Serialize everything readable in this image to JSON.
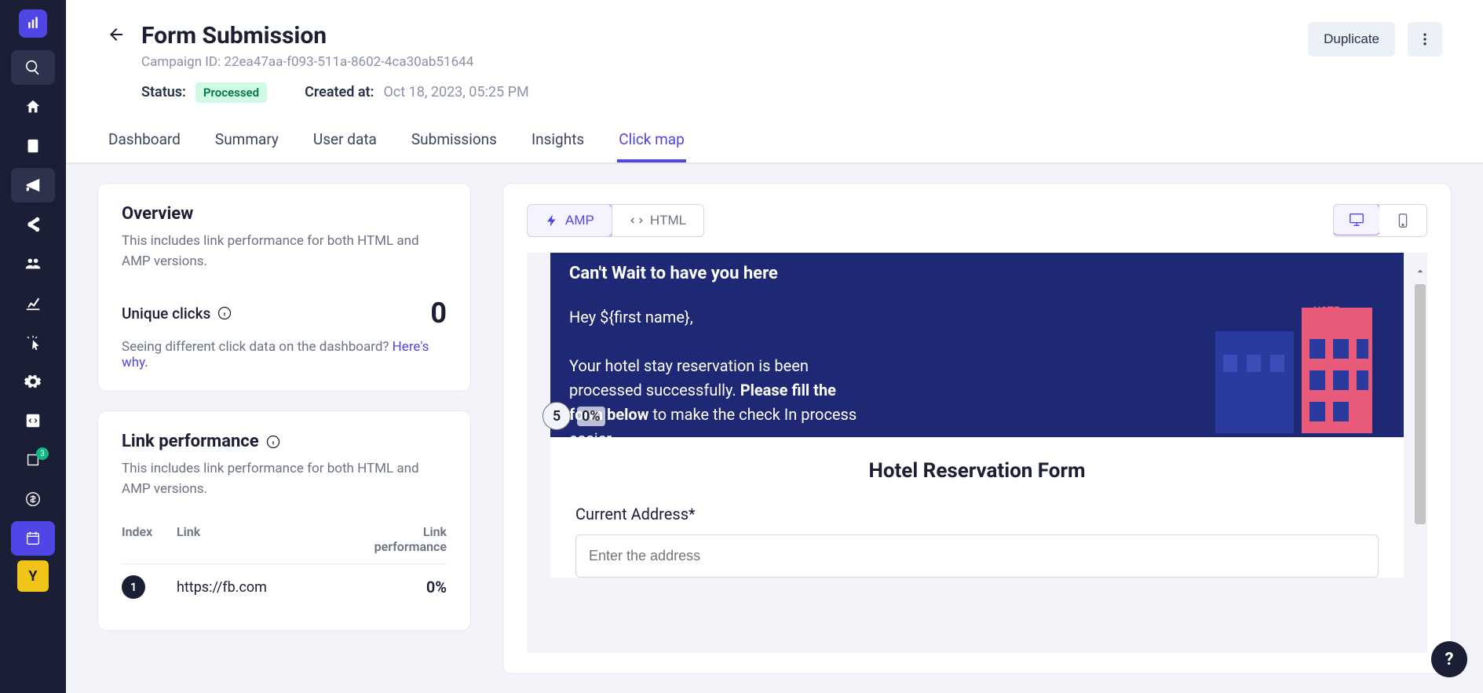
{
  "sidebar": {
    "badge_count": "3",
    "yellow_letter": "Y"
  },
  "header": {
    "title": "Form Submission",
    "campaign_id": "Campaign ID: 22ea47aa-f093-511a-8602-4ca30ab51644",
    "duplicate_label": "Duplicate",
    "status_label": "Status:",
    "status_value": "Processed",
    "created_label": "Created at:",
    "created_value": "Oct 18, 2023, 05:25 PM"
  },
  "tabs": [
    {
      "label": "Dashboard"
    },
    {
      "label": "Summary"
    },
    {
      "label": "User data"
    },
    {
      "label": "Submissions"
    },
    {
      "label": "Insights"
    },
    {
      "label": "Click map"
    }
  ],
  "overview": {
    "title": "Overview",
    "desc": "This includes link performance for both HTML and AMP versions.",
    "unique_label": "Unique clicks",
    "unique_value": "0",
    "help_text": "Seeing different click data on the dashboard? ",
    "help_link": "Here's why."
  },
  "link_perf": {
    "title": "Link performance",
    "desc": "This includes link performance for both HTML and AMP versions.",
    "col_index": "Index",
    "col_link": "Link",
    "col_perf": "Link performance",
    "rows": [
      {
        "idx": "1",
        "url": "https://fb.com",
        "perf": "0%"
      }
    ]
  },
  "preview": {
    "amp_label": "AMP",
    "html_label": "HTML",
    "hero_title": "Can't Wait to have you here",
    "greeting": "Hey ${first name},",
    "body_pre": "Your hotel stay reservation is been processed successfully. ",
    "body_strong": "Please fill the form below",
    "body_post": " to make the check In process easier.",
    "form_title": "Hotel Reservation Form",
    "field_label": "Current Address*",
    "field_placeholder": "Enter the address",
    "heat_num": "5",
    "heat_pct": "0%"
  },
  "help_fab": "?"
}
